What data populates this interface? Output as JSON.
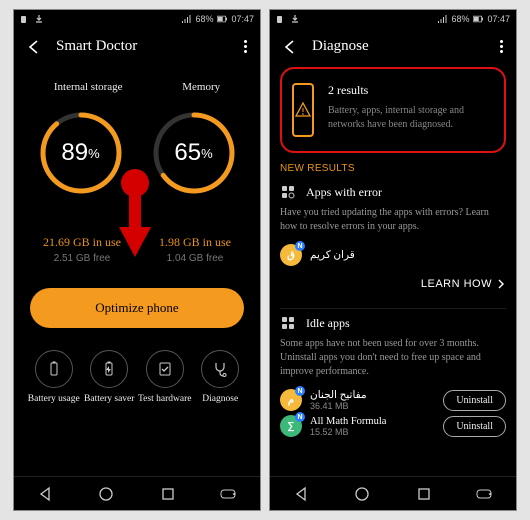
{
  "status": {
    "battery": "68%",
    "time": "07:47"
  },
  "left": {
    "title": "Smart Doctor",
    "storage_label": "Internal storage",
    "memory_label": "Memory",
    "storage_pct": "89",
    "memory_pct": "65",
    "pct_suffix": "%",
    "storage_use": "21.69 GB in use",
    "storage_free": "2.51 GB free",
    "memory_use": "1.98 GB in use",
    "memory_free": "1.04 GB free",
    "optimize": "Optimize phone",
    "tools": {
      "battery_usage": "Battery usage",
      "battery_saver": "Battery saver",
      "test_hw": "Test hardware",
      "diagnose": "Diagnose"
    }
  },
  "right": {
    "title": "Diagnose",
    "results_title": "2 results",
    "results_sub": "Battery, apps, internal storage and networks have been diagnosed.",
    "new_results": "NEW RESULTS",
    "apps_error_title": "Apps with error",
    "apps_error_desc": "Have you tried updating the apps with errors? Learn how to resolve errors in your apps.",
    "app1_name": "قران كريم",
    "learn_how": "LEARN HOW",
    "idle_title": "Idle apps",
    "idle_desc": "Some apps have not been used for over 3 months. Uninstall apps you don't need to free up space and improve performance.",
    "idle_app1_name": "مفاتيح الجنان",
    "idle_app1_size": "36.41 MB",
    "idle_app2_name": "All Math Formula",
    "idle_app2_size": "15.52 MB",
    "uninstall": "Uninstall"
  },
  "colors": {
    "accent": "#f39a1f"
  }
}
